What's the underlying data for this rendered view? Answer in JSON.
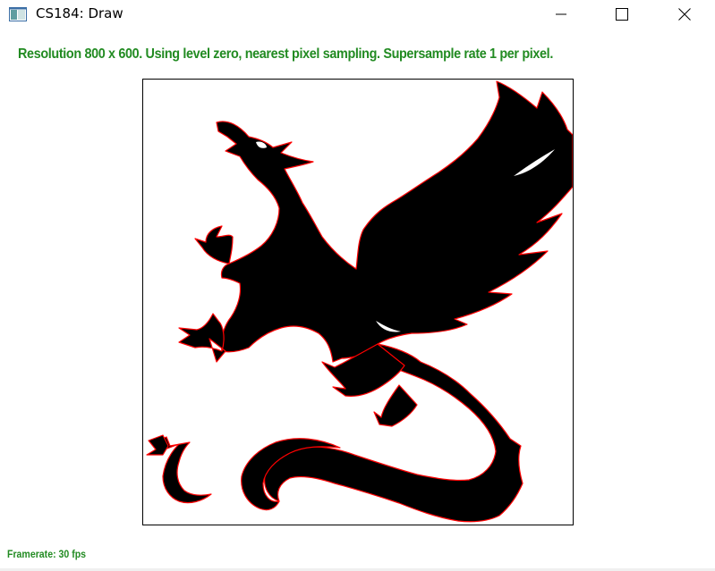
{
  "window": {
    "title": "CS184: Draw",
    "app_icon": "app-window-icon",
    "buttons": {
      "minimize_icon": "minimize-icon",
      "maximize_icon": "maximize-icon",
      "close_icon": "close-icon"
    }
  },
  "status": {
    "text": "Resolution 800 x 600. Using level zero, nearest pixel sampling. Supersample rate 1 per pixel."
  },
  "canvas": {
    "drawing": "dragon-silhouette",
    "fill_color": "#000000",
    "outline_color": "#ff0000"
  },
  "footer": {
    "framerate": "Framerate: 30 fps"
  },
  "colors": {
    "status_green": "#228B22",
    "background": "#ffffff"
  }
}
